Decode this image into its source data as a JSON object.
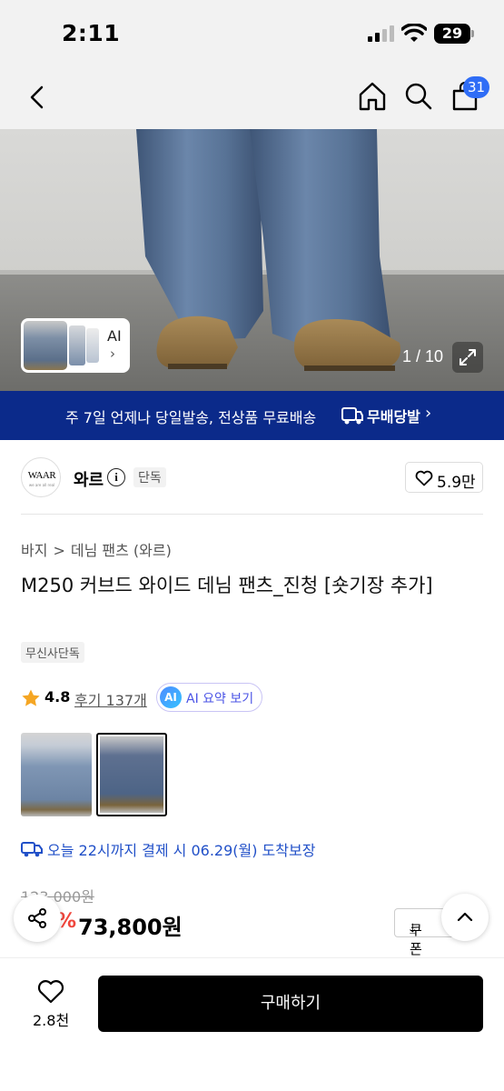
{
  "status_bar": {
    "time": "2:11",
    "battery": "29"
  },
  "nav": {
    "cart_count": "31"
  },
  "hero": {
    "thumb_label": "AI",
    "thumb_chevron": "›",
    "page_counter": "1 / 10"
  },
  "promo": {
    "text": "주 7일 언제나 당일발송, 전상품 무료배송",
    "brand": "무배당발",
    "chevron": "›"
  },
  "brand": {
    "logo_text": "WAAR",
    "logo_subtext": "we are all real",
    "name": "와르",
    "info_icon": "i",
    "tag": "단독",
    "likes": "5.9만"
  },
  "product": {
    "breadcrumb": [
      "바지",
      "데님 팬츠 (와르)"
    ],
    "breadcrumb_sep": ">",
    "title": "M250 커브드 와이드 데님 팬츠_진청 [숏기장 추가]",
    "exclusive_tag": "무신사단독",
    "rating": "4.8",
    "reviews": "후기 137개",
    "ai_badge": "AI",
    "ai_summary": "AI 요약 보기",
    "delivery": "오늘 22시까지 결제 시 06.29(월) 도착보장",
    "original_price": "123,000원",
    "discount": "%",
    "sale_price": "73,800원",
    "coupon": "쿠폰"
  },
  "bottom_bar": {
    "wish_count": "2.8천",
    "buy_label": "구매하기"
  },
  "colors": {
    "accent_blue": "#2f6df6",
    "promo_bg": "#0b2a8a",
    "discount_red": "#f0463c",
    "delivery_blue": "#2150c8",
    "star": "#f5a623"
  }
}
